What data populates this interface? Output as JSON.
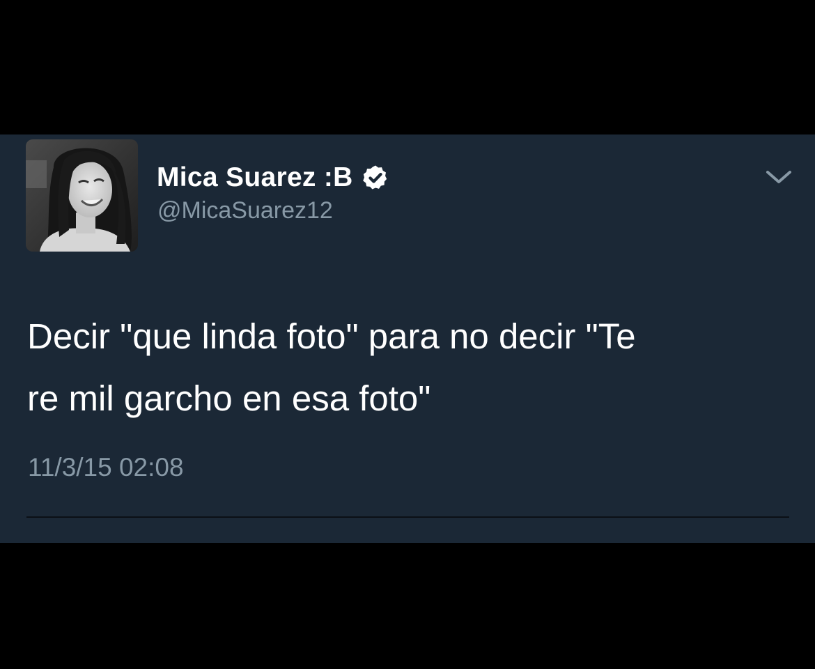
{
  "tweet": {
    "display_name": "Mica Suarez :B",
    "verified": true,
    "handle": "@MicaSuarez12",
    "text": "Decir \"que linda foto\" para no decir \"Te\nre mil garcho en esa foto\"",
    "timestamp": "11/3/15 02:08"
  },
  "icons": {
    "verified": "verified-badge-icon",
    "menu": "chevron-down-icon",
    "avatar": "profile-photo"
  },
  "colors": {
    "background": "#1b2836",
    "outer": "#000000",
    "name": "#ffffff",
    "secondary": "#8899a6"
  }
}
